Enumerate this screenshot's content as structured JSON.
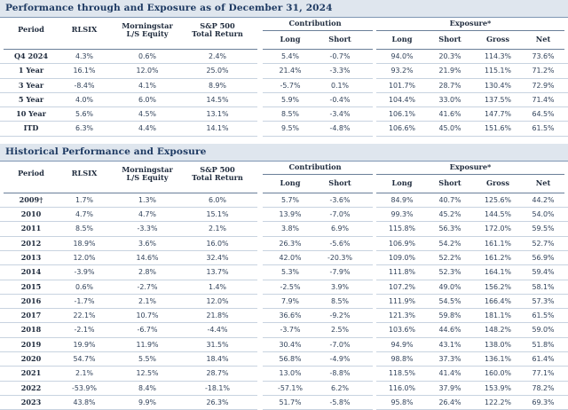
{
  "section1": {
    "title": "Performance through and Exposure as of December 31, 2024",
    "headers": {
      "period": "Period",
      "rlsix": "RLSIX",
      "morningstar": [
        "Morningstar",
        "L/S Equity"
      ],
      "sp500": [
        "S&P 500",
        "Total Return"
      ],
      "contribution": "Contribution",
      "exposure": "Exposure*",
      "long": "Long",
      "short": "Short",
      "exp_long": "Long",
      "exp_short": "Short",
      "gross": "Gross",
      "net": "Net"
    },
    "rows": [
      {
        "period": "Q4 2024",
        "rlsix": "4.3%",
        "ms": "0.6%",
        "sp": "2.4%",
        "c_long": "5.4%",
        "c_short": "-0.7%",
        "e_long": "94.0%",
        "e_short": "20.3%",
        "gross": "114.3%",
        "net": "73.6%"
      },
      {
        "period": "1 Year",
        "rlsix": "16.1%",
        "ms": "12.0%",
        "sp": "25.0%",
        "c_long": "21.4%",
        "c_short": "-3.3%",
        "e_long": "93.2%",
        "e_short": "21.9%",
        "gross": "115.1%",
        "net": "71.2%"
      },
      {
        "period": "3 Year",
        "rlsix": "-8.4%",
        "ms": "4.1%",
        "sp": "8.9%",
        "c_long": "-5.7%",
        "c_short": "0.1%",
        "e_long": "101.7%",
        "e_short": "28.7%",
        "gross": "130.4%",
        "net": "72.9%"
      },
      {
        "period": "5 Year",
        "rlsix": "4.0%",
        "ms": "6.0%",
        "sp": "14.5%",
        "c_long": "5.9%",
        "c_short": "-0.4%",
        "e_long": "104.4%",
        "e_short": "33.0%",
        "gross": "137.5%",
        "net": "71.4%"
      },
      {
        "period": "10 Year",
        "rlsix": "5.6%",
        "ms": "4.5%",
        "sp": "13.1%",
        "c_long": "8.5%",
        "c_short": "-3.4%",
        "e_long": "106.1%",
        "e_short": "41.6%",
        "gross": "147.7%",
        "net": "64.5%"
      },
      {
        "period": "ITD",
        "rlsix": "6.3%",
        "ms": "4.4%",
        "sp": "14.1%",
        "c_long": "9.5%",
        "c_short": "-4.8%",
        "e_long": "106.6%",
        "e_short": "45.0%",
        "gross": "151.6%",
        "net": "61.5%"
      }
    ]
  },
  "section2": {
    "title": "Historical Performance and Exposure",
    "headers": {
      "period": "Period",
      "rlsix": "RLSIX",
      "morningstar": [
        "Morningstar",
        "L/S Equity"
      ],
      "sp500": [
        "S&P 500",
        "Total Return"
      ],
      "contribution": "Contribution",
      "exposure": "Exposure*",
      "long": "Long",
      "short": "Short",
      "exp_long": "Long",
      "exp_short": "Short",
      "gross": "Gross",
      "net": "Net"
    },
    "rows": [
      {
        "period": "2009†",
        "rlsix": "1.7%",
        "ms": "1.3%",
        "sp": "6.0%",
        "c_long": "5.7%",
        "c_short": "-3.6%",
        "e_long": "84.9%",
        "e_short": "40.7%",
        "gross": "125.6%",
        "net": "44.2%"
      },
      {
        "period": "2010",
        "rlsix": "4.7%",
        "ms": "4.7%",
        "sp": "15.1%",
        "c_long": "13.9%",
        "c_short": "-7.0%",
        "e_long": "99.3%",
        "e_short": "45.2%",
        "gross": "144.5%",
        "net": "54.0%"
      },
      {
        "period": "2011",
        "rlsix": "8.5%",
        "ms": "-3.3%",
        "sp": "2.1%",
        "c_long": "3.8%",
        "c_short": "6.9%",
        "e_long": "115.8%",
        "e_short": "56.3%",
        "gross": "172.0%",
        "net": "59.5%"
      },
      {
        "period": "2012",
        "rlsix": "18.9%",
        "ms": "3.6%",
        "sp": "16.0%",
        "c_long": "26.3%",
        "c_short": "-5.6%",
        "e_long": "106.9%",
        "e_short": "54.2%",
        "gross": "161.1%",
        "net": "52.7%"
      },
      {
        "period": "2013",
        "rlsix": "12.0%",
        "ms": "14.6%",
        "sp": "32.4%",
        "c_long": "42.0%",
        "c_short": "-20.3%",
        "e_long": "109.0%",
        "e_short": "52.2%",
        "gross": "161.2%",
        "net": "56.9%"
      },
      {
        "period": "2014",
        "rlsix": "-3.9%",
        "ms": "2.8%",
        "sp": "13.7%",
        "c_long": "5.3%",
        "c_short": "-7.9%",
        "e_long": "111.8%",
        "e_short": "52.3%",
        "gross": "164.1%",
        "net": "59.4%"
      },
      {
        "period": "2015",
        "rlsix": "0.6%",
        "ms": "-2.7%",
        "sp": "1.4%",
        "c_long": "-2.5%",
        "c_short": "3.9%",
        "e_long": "107.2%",
        "e_short": "49.0%",
        "gross": "156.2%",
        "net": "58.1%"
      },
      {
        "period": "2016",
        "rlsix": "-1.7%",
        "ms": "2.1%",
        "sp": "12.0%",
        "c_long": "7.9%",
        "c_short": "8.5%",
        "e_long": "111.9%",
        "e_short": "54.5%",
        "gross": "166.4%",
        "net": "57.3%"
      },
      {
        "period": "2017",
        "rlsix": "22.1%",
        "ms": "10.7%",
        "sp": "21.8%",
        "c_long": "36.6%",
        "c_short": "-9.2%",
        "e_long": "121.3%",
        "e_short": "59.8%",
        "gross": "181.1%",
        "net": "61.5%"
      },
      {
        "period": "2018",
        "rlsix": "-2.1%",
        "ms": "-6.7%",
        "sp": "-4.4%",
        "c_long": "-3.7%",
        "c_short": "2.5%",
        "e_long": "103.6%",
        "e_short": "44.6%",
        "gross": "148.2%",
        "net": "59.0%"
      },
      {
        "period": "2019",
        "rlsix": "19.9%",
        "ms": "11.9%",
        "sp": "31.5%",
        "c_long": "30.4%",
        "c_short": "-7.0%",
        "e_long": "94.9%",
        "e_short": "43.1%",
        "gross": "138.0%",
        "net": "51.8%"
      },
      {
        "period": "2020",
        "rlsix": "54.7%",
        "ms": "5.5%",
        "sp": "18.4%",
        "c_long": "56.8%",
        "c_short": "-4.9%",
        "e_long": "98.8%",
        "e_short": "37.3%",
        "gross": "136.1%",
        "net": "61.4%"
      },
      {
        "period": "2021",
        "rlsix": "2.1%",
        "ms": "12.5%",
        "sp": "28.7%",
        "c_long": "13.0%",
        "c_short": "-8.8%",
        "e_long": "118.5%",
        "e_short": "41.4%",
        "gross": "160.0%",
        "net": "77.1%"
      },
      {
        "period": "2022",
        "rlsix": "-53.9%",
        "ms": "8.4%",
        "sp": "-18.1%",
        "c_long": "-57.1%",
        "c_short": "6.2%",
        "e_long": "116.0%",
        "e_short": "37.9%",
        "gross": "153.9%",
        "net": "78.2%"
      },
      {
        "period": "2023",
        "rlsix": "43.8%",
        "ms": "9.9%",
        "sp": "26.3%",
        "c_long": "51.7%",
        "c_short": "-5.8%",
        "e_long": "95.8%",
        "e_short": "26.4%",
        "gross": "122.2%",
        "net": "69.3%"
      }
    ]
  }
}
